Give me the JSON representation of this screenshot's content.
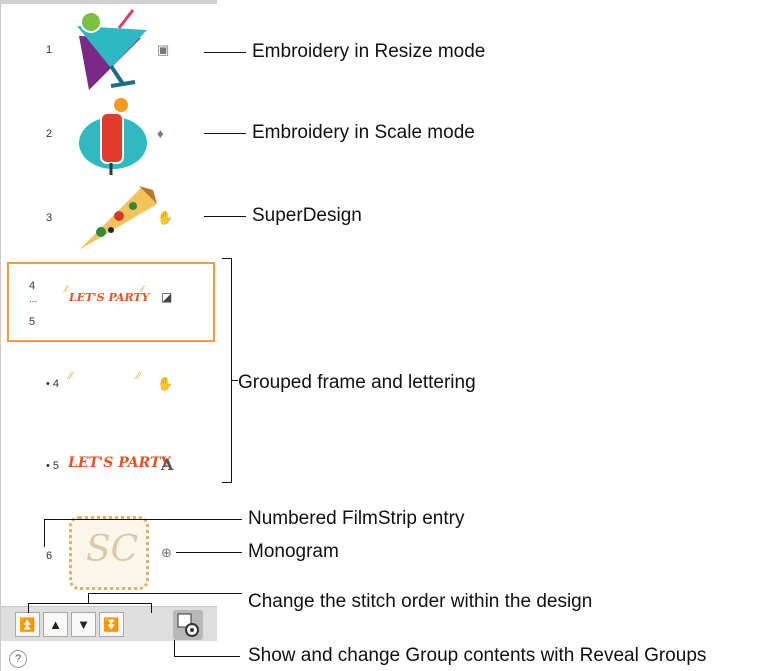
{
  "filmstrip": {
    "entries": [
      {
        "number": "1",
        "icon": "resize-mode-icon"
      },
      {
        "number": "2",
        "icon": "scale-mode-icon"
      },
      {
        "number": "3",
        "icon": "superdesign-icon"
      },
      {
        "number": "4",
        "number_sep": "...",
        "number_end": "5",
        "text": "LET'S PARTY",
        "icon": "group-icon",
        "selected": true
      },
      {
        "number": "• 4",
        "icon": "superdesign-icon"
      },
      {
        "number": "• 5",
        "text": "LET'S PARTY",
        "icon_letter": "A"
      },
      {
        "number": "6",
        "text": "SC",
        "icon": "monogram-icon"
      }
    ]
  },
  "toolbar": {
    "buttons": [
      "move-to-start-icon",
      "move-up-icon",
      "move-down-icon",
      "move-to-end-icon",
      "reveal-groups-icon"
    ],
    "help": "?"
  },
  "callouts": {
    "resize": "Embroidery in Resize mode",
    "scale": "Embroidery in Scale mode",
    "superdesign": "SuperDesign",
    "grouped": "Grouped frame and lettering",
    "numbered": "Numbered FilmStrip entry",
    "monogram": "Monogram",
    "stitch_order": "Change the stitch order within the design",
    "reveal": "Show and change Group contents with Reveal Groups"
  },
  "colors": {
    "selection": "#f29a45",
    "lettering": "#e8521f",
    "toolbar": "#dedede"
  }
}
